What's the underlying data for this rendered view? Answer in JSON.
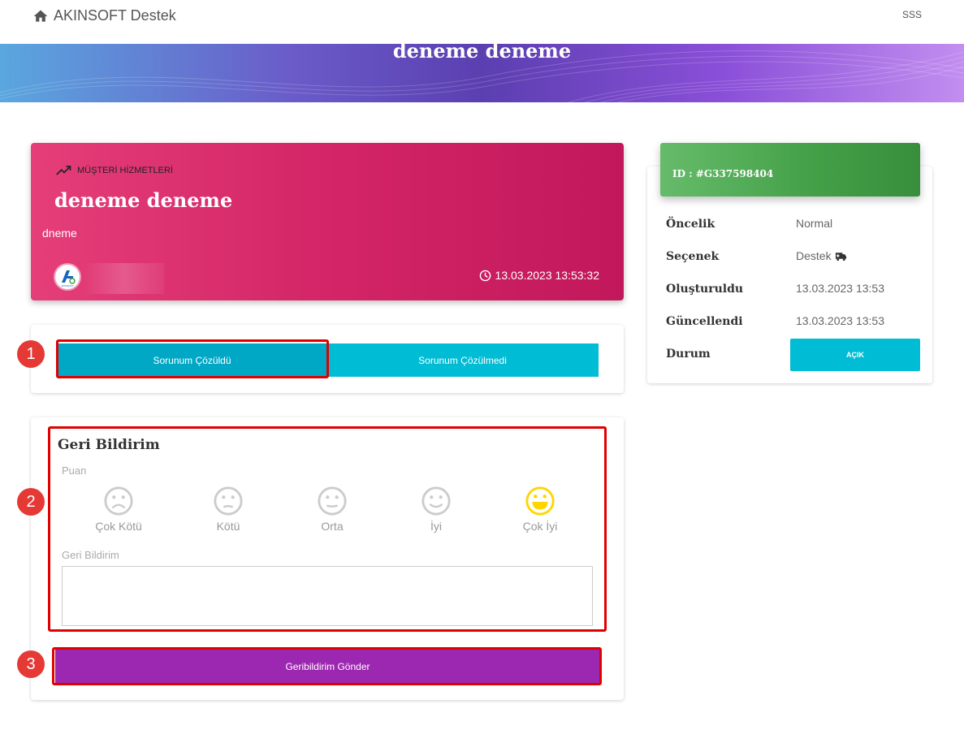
{
  "header": {
    "brand": "AKINSOFT Destek",
    "sss": "SSS"
  },
  "hero": {
    "title": "deneme deneme"
  },
  "ticket": {
    "department": "MÜŞTERİ HİZMETLERİ",
    "title": "deneme deneme",
    "description": "dneme",
    "date": "13.03.2023 13:53:32",
    "logo_text": "AKINSOFT"
  },
  "actions": {
    "solved": "Sorunum Çözüldü",
    "unsolved": "Sorunum Çözülmedi"
  },
  "feedback": {
    "title": "Geri Bildirim",
    "rating_label": "Puan",
    "ratings": [
      "Çok Kötü",
      "Kötü",
      "Orta",
      "İyi",
      "Çok İyi"
    ],
    "selected_rating": "Çok İyi",
    "comment_label": "Geri Bildirim",
    "comment_value": "",
    "send": "Geribildirim Gönder"
  },
  "info": {
    "id": "ID : #G337598404",
    "rows": [
      {
        "key": "Öncelik",
        "value": "Normal"
      },
      {
        "key": "Seçenek",
        "value": "Destek"
      },
      {
        "key": "Oluşturuldu",
        "value": "13.03.2023 13:53"
      },
      {
        "key": "Güncellendi",
        "value": "13.03.2023 13:53"
      },
      {
        "key": "Durum",
        "value": "AÇIK"
      }
    ]
  },
  "annotations": [
    "1",
    "2",
    "3"
  ],
  "colors": {
    "accent_cyan": "#00bcd4",
    "ticket_pink": "#d32567",
    "send_purple": "#9c27b0",
    "id_green": "#43a047",
    "highlight_red": "#e00000",
    "smile_yellow": "#ffd600"
  }
}
